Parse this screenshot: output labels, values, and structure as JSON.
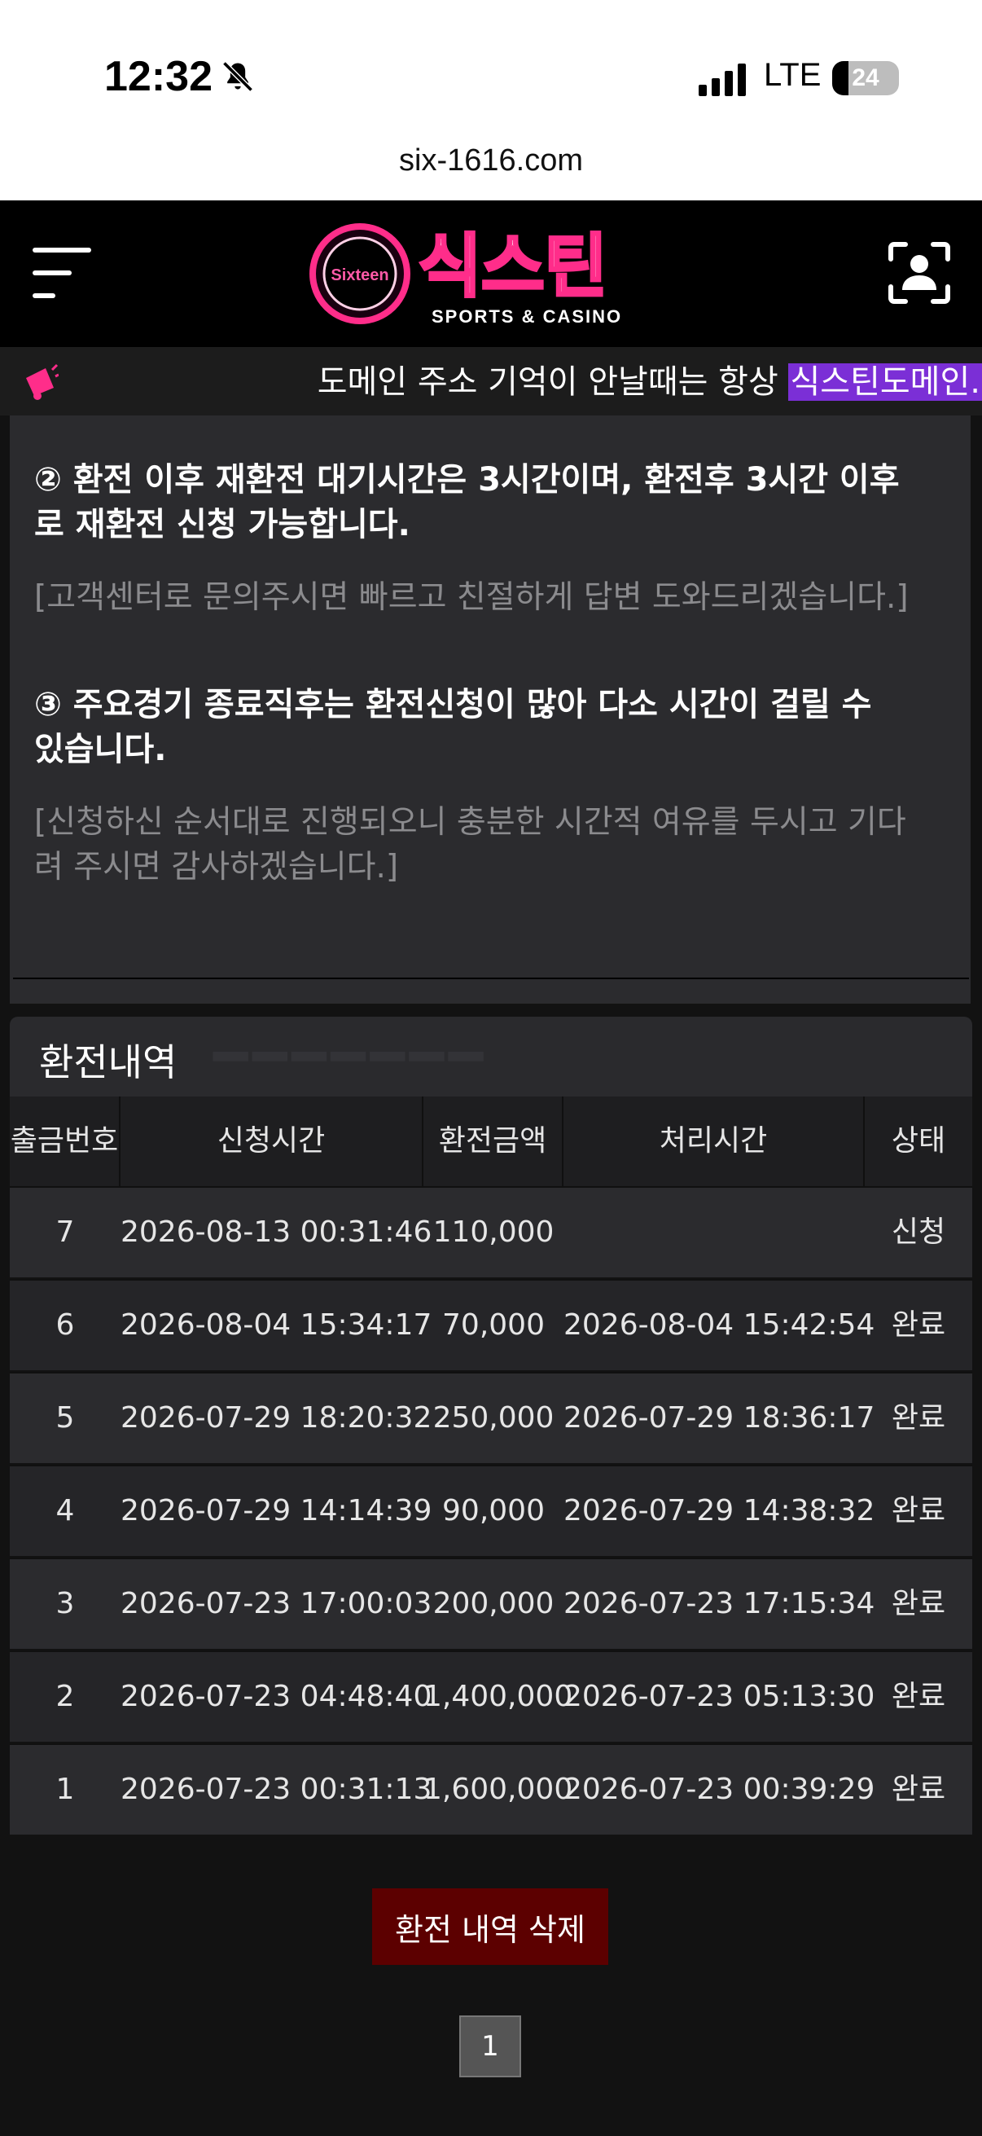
{
  "status_bar": {
    "time": "12:32",
    "network": "LTE",
    "battery": "24"
  },
  "browser": {
    "url": "six-1616.com"
  },
  "header": {
    "logo_badge": "Sixteen",
    "logo_title": "식스틴",
    "logo_subtitle": "SPORTS & CASINO"
  },
  "notice": {
    "text": "도메인 주소 기억이 안날때는 항상 ",
    "highlight": "식스틴도메인."
  },
  "info": {
    "p2_main_line1": "② 환전 이후 재환전 대기시간은 3시간이며, 환전후 3시간 이후",
    "p2_main_line2": "로 재환전 신청 가능합니다.",
    "p2_sub": "[고객센터로 문의주시면 빠르고 친절하게 답변 도와드리겠습니다.]",
    "p3_main_line1": "③ 주요경기 종료직후는 환전신청이 많아 다소 시간이 걸릴 수",
    "p3_main_line2": "있습니다.",
    "p3_sub_line1": "[신청하신 순서대로 진행되오니 충분한 시간적 여유를 두시고 기다",
    "p3_sub_line2": "려 주시면 감사하겠습니다.]"
  },
  "history": {
    "title": "환전내역",
    "columns": [
      "출금번호",
      "신청시간",
      "환전금액",
      "처리시간",
      "상태"
    ],
    "rows": [
      [
        "7",
        "2026-08-13 00:31:46",
        "110,000",
        "",
        "신청"
      ],
      [
        "6",
        "2026-08-04 15:34:17",
        "70,000",
        "2026-08-04 15:42:54",
        "완료"
      ],
      [
        "5",
        "2026-07-29 18:20:32",
        "250,000",
        "2026-07-29 18:36:17",
        "완료"
      ],
      [
        "4",
        "2026-07-29 14:14:39",
        "90,000",
        "2026-07-29 14:38:32",
        "완료"
      ],
      [
        "3",
        "2026-07-23 17:00:03",
        "200,000",
        "2026-07-23 17:15:34",
        "완료"
      ],
      [
        "2",
        "2026-07-23 04:48:40",
        "1,400,000",
        "2026-07-23 05:13:30",
        "완료"
      ],
      [
        "1",
        "2026-07-23 00:31:13",
        "1,600,000",
        "2026-07-23 00:39:29",
        "완료"
      ]
    ],
    "delete_label": "환전 내역 삭제",
    "page": "1"
  },
  "colors": {
    "accent": "#ff2d8a",
    "highlight": "#7b2fd6",
    "delete": "#5c0000"
  },
  "icons": [
    "bell-slash-icon",
    "signal-icon",
    "battery-icon",
    "menu-icon",
    "user-scan-icon",
    "notice-icon"
  ]
}
